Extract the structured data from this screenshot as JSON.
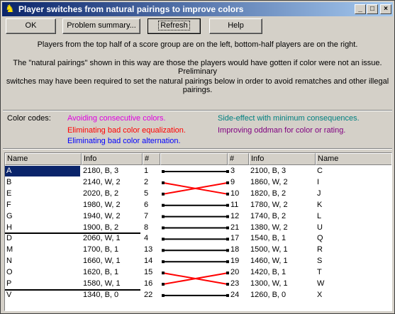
{
  "window": {
    "title": "Player switches from natural pairings to improve colors",
    "controls": [
      "_",
      "□",
      "×"
    ]
  },
  "buttons": {
    "ok": "OK",
    "problem_summary": "Problem summary...",
    "refresh": "Refresh",
    "help": "Help"
  },
  "notes": {
    "line1": "Players from the top half of a score group are on the left, bottom-half players are on the right.",
    "line2": "The \"natural pairings\" shown in this way are those the players would have gotten if color were not an issue. Preliminary",
    "line3": "switches may have been required to set the natural pairings below in order to avoid rematches and other illegal",
    "line4": "pairings."
  },
  "color_codes": {
    "label": "Color codes:",
    "items": [
      {
        "text": "Avoiding consecutive colors.",
        "color": "#e000e0"
      },
      {
        "text": "Side-effect with minimum consequences.",
        "color": "#008080"
      },
      {
        "text": "Eliminating bad color equalization.",
        "color": "#ff0000"
      },
      {
        "text": "Improving oddman for color or rating.",
        "color": "#800080"
      },
      {
        "text": "Eliminating bad color alternation.",
        "color": "#0000ff"
      }
    ]
  },
  "table": {
    "headers": [
      "Name",
      "Info",
      "#",
      "",
      "#",
      "Info",
      "Name"
    ],
    "rows": [
      {
        "lname": "A",
        "linfo": "2180, B, 3",
        "lnum": "1",
        "rnum": "3",
        "rinfo": "2100, B, 3",
        "rname": "C",
        "swap": false
      },
      {
        "lname": "B",
        "linfo": "2140, W, 2",
        "lnum": "2",
        "rnum": "9",
        "rinfo": "1860, W, 2",
        "rname": "I",
        "swap": true
      },
      {
        "lname": "E",
        "linfo": "2020, B, 2",
        "lnum": "5",
        "rnum": "10",
        "rinfo": "1820, B, 2",
        "rname": "J",
        "swap": true
      },
      {
        "lname": "F",
        "linfo": "1980, W, 2",
        "lnum": "6",
        "rnum": "11",
        "rinfo": "1780, W, 2",
        "rname": "K",
        "swap": false
      },
      {
        "lname": "G",
        "linfo": "1940, W, 2",
        "lnum": "7",
        "rnum": "12",
        "rinfo": "1740, B, 2",
        "rname": "L",
        "swap": false
      },
      {
        "lname": "H",
        "linfo": "1900, B, 2",
        "lnum": "8",
        "rnum": "21",
        "rinfo": "1380, W, 2",
        "rname": "U",
        "swap": false
      },
      {
        "lname": "D",
        "linfo": "2060, W, 1",
        "lnum": "4",
        "rnum": "17",
        "rinfo": "1540, B, 1",
        "rname": "Q",
        "swap": false
      },
      {
        "lname": "M",
        "linfo": "1700, B, 1",
        "lnum": "13",
        "rnum": "18",
        "rinfo": "1500, W, 1",
        "rname": "R",
        "swap": false
      },
      {
        "lname": "N",
        "linfo": "1660, W, 1",
        "lnum": "14",
        "rnum": "19",
        "rinfo": "1460, W, 1",
        "rname": "S",
        "swap": false
      },
      {
        "lname": "O",
        "linfo": "1620, B, 1",
        "lnum": "15",
        "rnum": "20",
        "rinfo": "1420, B, 1",
        "rname": "T",
        "swap": true
      },
      {
        "lname": "P",
        "linfo": "1580, W, 1",
        "lnum": "16",
        "rnum": "23",
        "rinfo": "1300, W, 1",
        "rname": "W",
        "swap": true
      },
      {
        "lname": "V",
        "linfo": "1340, B, 0",
        "lnum": "22",
        "rnum": "24",
        "rinfo": "1260, B, 0",
        "rname": "X",
        "swap": false
      }
    ],
    "selected_row": 0,
    "group_separators_after": [
      5,
      10
    ],
    "swap_color": "#ff0000",
    "line_color": "#000000"
  }
}
